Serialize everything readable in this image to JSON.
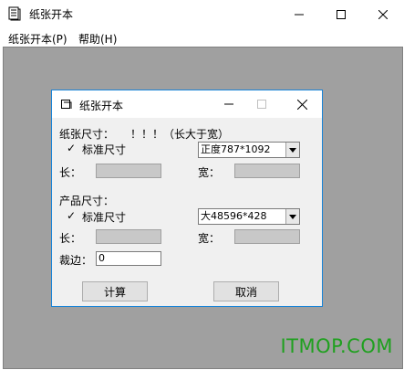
{
  "window": {
    "title": "纸张开本",
    "icon": "document-icon"
  },
  "menu": {
    "items": [
      {
        "label": "纸张开本(P)"
      },
      {
        "label": "帮助(H)"
      }
    ]
  },
  "dialog": {
    "title": "纸张开本",
    "paper_section": {
      "label": "纸张尺寸：",
      "hint": "！！！（长大于宽）",
      "checkbox_label": "标准尺寸",
      "checked": true,
      "combo_value": "正度787*1092",
      "length_label": "长：",
      "width_label": "宽："
    },
    "product_section": {
      "label": "产品尺寸：",
      "checkbox_label": "标准尺寸",
      "checked": true,
      "combo_value": "大48596*428",
      "length_label": "长：",
      "width_label": "宽："
    },
    "trim": {
      "label": "裁边：",
      "value": "0"
    },
    "buttons": {
      "calculate": "计算",
      "cancel": "取消"
    }
  },
  "watermark": "ITMOP.COM",
  "colors": {
    "dialog_border": "#1883d7",
    "client_bg": "#a0a0a0",
    "watermark": "#1fa01f"
  }
}
